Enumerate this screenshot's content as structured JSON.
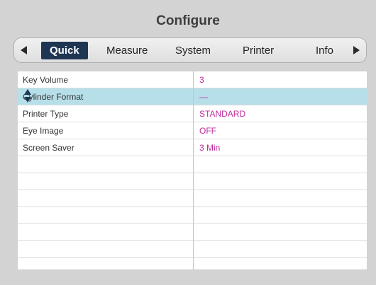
{
  "window": {
    "title": "Configure"
  },
  "tabs": [
    {
      "label": "Quick",
      "active": true
    },
    {
      "label": "Measure"
    },
    {
      "label": "System"
    },
    {
      "label": "Printer"
    },
    {
      "label": "Info"
    }
  ],
  "settings": [
    {
      "label": "Key Volume",
      "value": "3"
    },
    {
      "label": "Cylinder Format",
      "value": "—",
      "selected": true
    },
    {
      "label": "Printer Type",
      "value": "STANDARD"
    },
    {
      "label": "Eye Image",
      "value": "OFF"
    },
    {
      "label": "Screen Saver",
      "value": "3 Min"
    },
    {
      "label": "",
      "value": ""
    },
    {
      "label": "",
      "value": ""
    },
    {
      "label": "",
      "value": ""
    },
    {
      "label": "",
      "value": ""
    },
    {
      "label": "",
      "value": ""
    },
    {
      "label": "",
      "value": ""
    }
  ],
  "icons": {
    "prev": "triangle-left-icon",
    "next": "triangle-right-icon",
    "selection": "up-down-arrows-icon"
  },
  "colors": {
    "active_tab": "#1f3653",
    "value_text": "#c02c9e",
    "selected_row": "#b7dfea",
    "background": "#d3d3d3"
  }
}
